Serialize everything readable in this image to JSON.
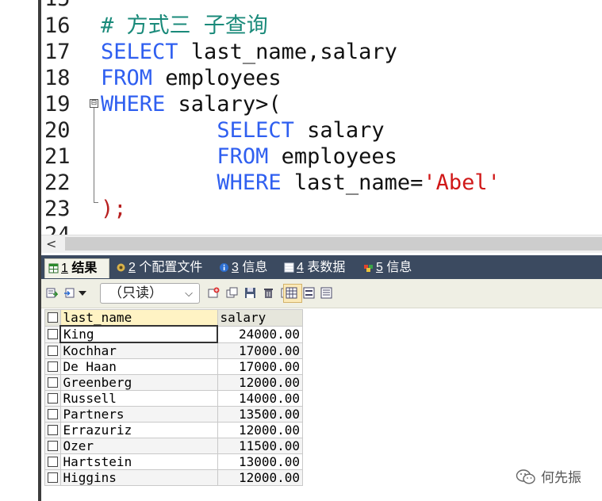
{
  "editor": {
    "partial_top_line": "15",
    "partial_bottom_line": "24",
    "lines": [
      {
        "num": "16",
        "comment": "# 方式三 子查询"
      },
      {
        "num": "17",
        "kw": "SELECT",
        "rest": " last_name,salary"
      },
      {
        "num": "18",
        "kw": "FROM",
        "rest": " employees"
      },
      {
        "num": "19",
        "kw": "WHERE",
        "rest": " salary>("
      },
      {
        "num": "20",
        "indent": "         ",
        "kw": "SELECT",
        "rest": " salary"
      },
      {
        "num": "21",
        "indent": "         ",
        "kw": "FROM",
        "rest": " employees"
      },
      {
        "num": "22",
        "indent": "         ",
        "kw": "WHERE",
        "rest": " last_name=",
        "string": "'Abel'"
      },
      {
        "num": "23",
        "punct": ");"
      }
    ],
    "fold_marker": "⊟"
  },
  "hscroll": {
    "left_arrow": "<"
  },
  "result_tabs": [
    {
      "num": "1",
      "label": " 结果",
      "icon": "result-grid-icon",
      "active": true
    },
    {
      "num": "2",
      "label": " 个配置文件",
      "icon": "profile-icon",
      "active": false
    },
    {
      "num": "3",
      "label": " 信息",
      "icon": "info-icon",
      "active": false
    },
    {
      "num": "4",
      "label": " 表数据",
      "icon": "table-data-icon",
      "active": false
    },
    {
      "num": "5",
      "label": " 信息",
      "icon": "messages-icon",
      "active": false
    }
  ],
  "toolbar": {
    "readonly_select": "（只读）",
    "readonly_arrow": "⌵"
  },
  "grid": {
    "columns": [
      "last_name",
      "salary"
    ],
    "rows": [
      {
        "last_name": "King",
        "salary": "24000.00"
      },
      {
        "last_name": "Kochhar",
        "salary": "17000.00"
      },
      {
        "last_name": "De Haan",
        "salary": "17000.00"
      },
      {
        "last_name": "Greenberg",
        "salary": "12000.00"
      },
      {
        "last_name": "Russell",
        "salary": "14000.00"
      },
      {
        "last_name": "Partners",
        "salary": "13500.00"
      },
      {
        "last_name": "Errazuriz",
        "salary": "12000.00"
      },
      {
        "last_name": "Ozer",
        "salary": "11500.00"
      },
      {
        "last_name": "Hartstein",
        "salary": "13000.00"
      },
      {
        "last_name": "Higgins",
        "salary": "12000.00"
      }
    ]
  },
  "watermark": {
    "text": "何先振"
  },
  "colors": {
    "keyword": "#2f5ff0",
    "comment": "#1a8a7a",
    "string": "#d01818",
    "tabbar": "#3b4a60"
  }
}
